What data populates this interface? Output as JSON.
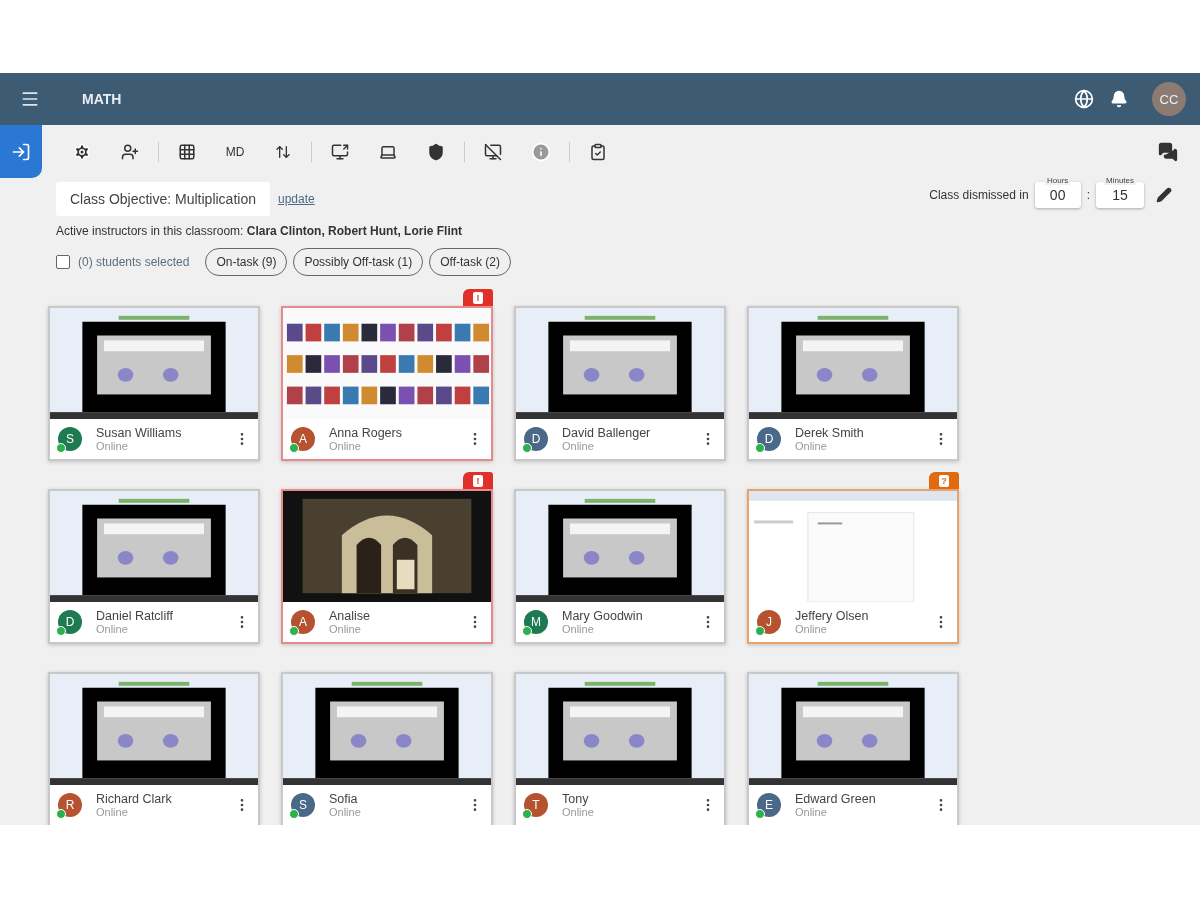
{
  "header": {
    "title": "MATH",
    "avatar": "CC"
  },
  "toolbar": {
    "text_button": "MD"
  },
  "objective": {
    "text": "Class Objective: Multiplication",
    "link": "update"
  },
  "instructors": "Active instructors in this classroom: **Clara Clinton, Robert Hunt, Lorie Flint**",
  "timer": {
    "label": "Class dismissed in",
    "hours_label": "Hours",
    "hours": "00",
    "separator": ":",
    "minutes_label": "Minutes",
    "minutes": "15"
  },
  "selection": {
    "label": "(0) students selected",
    "checked": false
  },
  "filters": [
    {
      "label": "On-task (9)",
      "selected": false
    },
    {
      "label": "Possibly Off-task (1)",
      "selected": false
    },
    {
      "label": "Off-task (2)",
      "selected": false
    }
  ],
  "students": [
    {
      "name": "Susan Williams",
      "initial": "S",
      "color": "#1e7a50",
      "status_text": "Online",
      "online": true,
      "off_task": false,
      "possibly_off_task": false
    },
    {
      "name": "Anna Rogers",
      "initial": "A",
      "color": "#b5522f",
      "status_text": "Online",
      "online": true,
      "off_task": true,
      "possibly_off_task": false,
      "badge": "!"
    },
    {
      "name": "David Ballenger",
      "initial": "D",
      "color": "#4a6888",
      "status_text": "Online",
      "online": true,
      "off_task": false,
      "possibly_off_task": false
    },
    {
      "name": "Derek Smith",
      "initial": "D",
      "color": "#4a6888",
      "status_text": "Online",
      "online": true,
      "off_task": false,
      "possibly_off_task": false
    },
    {
      "name": "Daniel Ratcliff",
      "initial": "D",
      "color": "#1e7a50",
      "status_text": "Online",
      "online": true,
      "off_task": false,
      "possibly_off_task": false
    },
    {
      "name": "Analise",
      "initial": "A",
      "color": "#b5522f",
      "status_text": "Online",
      "online": true,
      "off_task": true,
      "possibly_off_task": false,
      "badge": "!"
    },
    {
      "name": "Mary Goodwin",
      "initial": "M",
      "color": "#1e7a50",
      "status_text": "Online",
      "online": true,
      "off_task": false,
      "possibly_off_task": false
    },
    {
      "name": "Jeffery Olsen",
      "initial": "J",
      "color": "#b5522f",
      "status_text": "Online",
      "online": true,
      "off_task": false,
      "possibly_off_task": true,
      "badge": "?"
    },
    {
      "name": "Richard Clark",
      "initial": "R",
      "color": "#b5522f",
      "status_text": "Online",
      "online": true,
      "off_task": false,
      "possibly_off_task": false
    },
    {
      "name": "Sofia",
      "initial": "S",
      "color": "#4a6888",
      "status_text": "Online",
      "online": true,
      "off_task": false,
      "possibly_off_task": false
    },
    {
      "name": "Tony",
      "initial": "T",
      "color": "#b5522f",
      "status_text": "Online",
      "online": true,
      "off_task": false,
      "possibly_off_task": false
    },
    {
      "name": "Edward Green",
      "initial": "E",
      "color": "#4a6888",
      "status_text": "Online",
      "online": true,
      "off_task": false,
      "possibly_off_task": false
    }
  ]
}
